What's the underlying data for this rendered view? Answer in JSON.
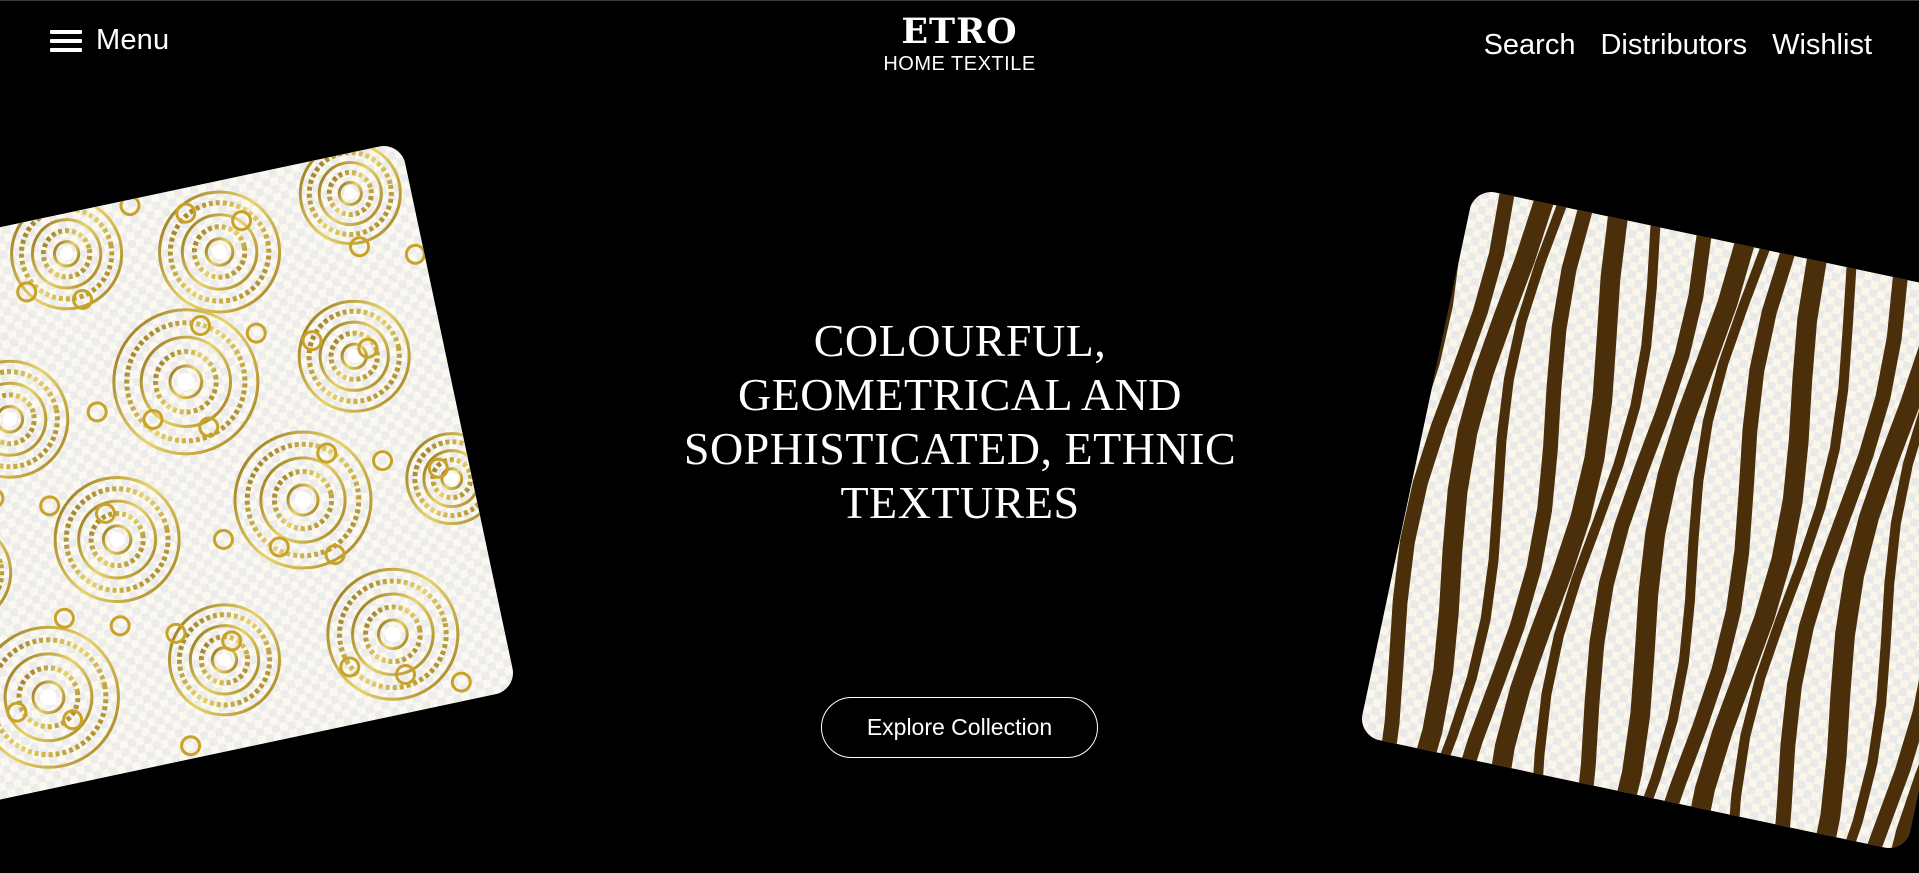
{
  "header": {
    "menu_label": "Menu",
    "brand_name": "ETRO",
    "brand_subtitle": "HOME TEXTILE",
    "nav": [
      {
        "label": "Search"
      },
      {
        "label": "Distributors"
      },
      {
        "label": "Wishlist"
      }
    ]
  },
  "hero": {
    "title_lines": [
      "COLOURFUL,",
      "GEOMETRICAL AND",
      "SOPHISTICATED, ETHNIC",
      "TEXTURES"
    ],
    "cta_label": "Explore Collection"
  },
  "images": {
    "left": "gold-mandala-pattern",
    "right": "zebra-stripe-pattern"
  },
  "colors": {
    "background": "#000000",
    "text": "#ffffff",
    "gold": "#c9a227",
    "stripe": "#4a2f0a"
  }
}
